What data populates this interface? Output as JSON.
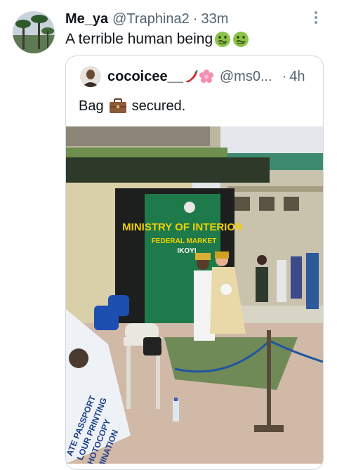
{
  "tweet": {
    "display_name": "Me_ya",
    "handle": "@Traphina2",
    "separator": "·",
    "time": "33m",
    "text": "A terrible human being",
    "emojis": [
      "nauseated-face",
      "nauseated-face"
    ],
    "more_icon": "more-vertical-icon"
  },
  "quoted": {
    "display_name": "cocoicee__",
    "name_emojis": [
      "chili-pepper",
      "cherry-blossom"
    ],
    "handle": "@ms0...",
    "separator": "·",
    "time": "4h",
    "text_before": "Bag",
    "text_emoji": "briefcase",
    "text_after": "secured.",
    "photo": {
      "sign_line1": "MINISTRY OF INTERIOR",
      "sign_line2": "FEDERAL MARKET",
      "sign_line3": "IKOYI",
      "banner_lines": [
        "ATE PASSPORT",
        "LOUR PRINTING",
        "HOTOCOPY",
        "MINATION"
      ]
    }
  },
  "colors": {
    "text": "#0f1419",
    "secondary": "#536471",
    "border": "#cfd9de",
    "sign_green": "#1e7a4a",
    "sign_yellow": "#f0d000"
  }
}
